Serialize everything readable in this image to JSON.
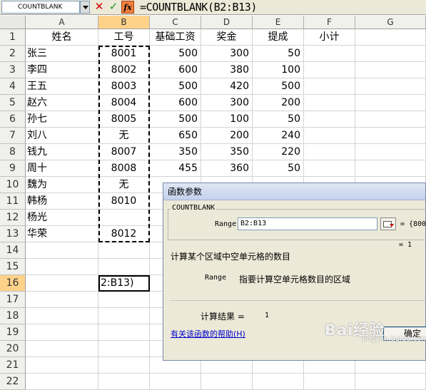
{
  "formula_bar": {
    "name_box": "COUNTBLANK",
    "cancel_symbol": "✕",
    "enter_symbol": "✓",
    "fx_label": "fx",
    "formula": "=COUNTBLANK(B2:B13)"
  },
  "sheet": {
    "columns": [
      "A",
      "B",
      "C",
      "D",
      "E",
      "F",
      "G"
    ],
    "row_numbers": [
      "1",
      "2",
      "3",
      "4",
      "5",
      "6",
      "7",
      "8",
      "9",
      "10",
      "11",
      "12",
      "13",
      "14",
      "15",
      "16",
      "17",
      "18",
      "19",
      "20",
      "21",
      "22"
    ],
    "header_row": [
      "姓名",
      "工号",
      "基础工资",
      "奖金",
      "提成",
      "小计"
    ],
    "rows": [
      [
        "张三",
        "8001",
        "500",
        "300",
        "50"
      ],
      [
        "李四",
        "8002",
        "600",
        "380",
        "100"
      ],
      [
        "王五",
        "8003",
        "500",
        "420",
        "500"
      ],
      [
        "赵六",
        "8004",
        "600",
        "300",
        "200"
      ],
      [
        "孙七",
        "8005",
        "500",
        "100",
        "50"
      ],
      [
        "刘八",
        "无",
        "650",
        "200",
        "240"
      ],
      [
        "钱九",
        "8007",
        "350",
        "350",
        "220"
      ],
      [
        "周十",
        "8008",
        "455",
        "360",
        "50"
      ],
      [
        "魏为",
        "无",
        "",
        "",
        ""
      ],
      [
        "韩杨",
        "8010",
        "",
        "",
        ""
      ],
      [
        "杨光",
        "",
        "",
        "",
        ""
      ],
      [
        "华荣",
        "8012",
        "",
        "",
        ""
      ]
    ],
    "active_cell_text": "2:B13)"
  },
  "dialog": {
    "title": "函数参数",
    "function_name": "COUNTBLANK",
    "arg_label": "Range",
    "arg_value": "B2:B13",
    "arg_equals": "=",
    "arg_preview": "{800",
    "result_inline": "= 1",
    "description": "计算某个区域中空单元格的数目",
    "param_name": "Range",
    "param_description": "指要计算空单元格数目的区域",
    "calc_result_label": "计算结果 =",
    "calc_result_value": "1",
    "help_link": "有关该函数的帮助(H)",
    "ok_button": "确定"
  },
  "watermark": {
    "text": "Bai经验",
    "sub": "jingyan.baidu.com"
  }
}
